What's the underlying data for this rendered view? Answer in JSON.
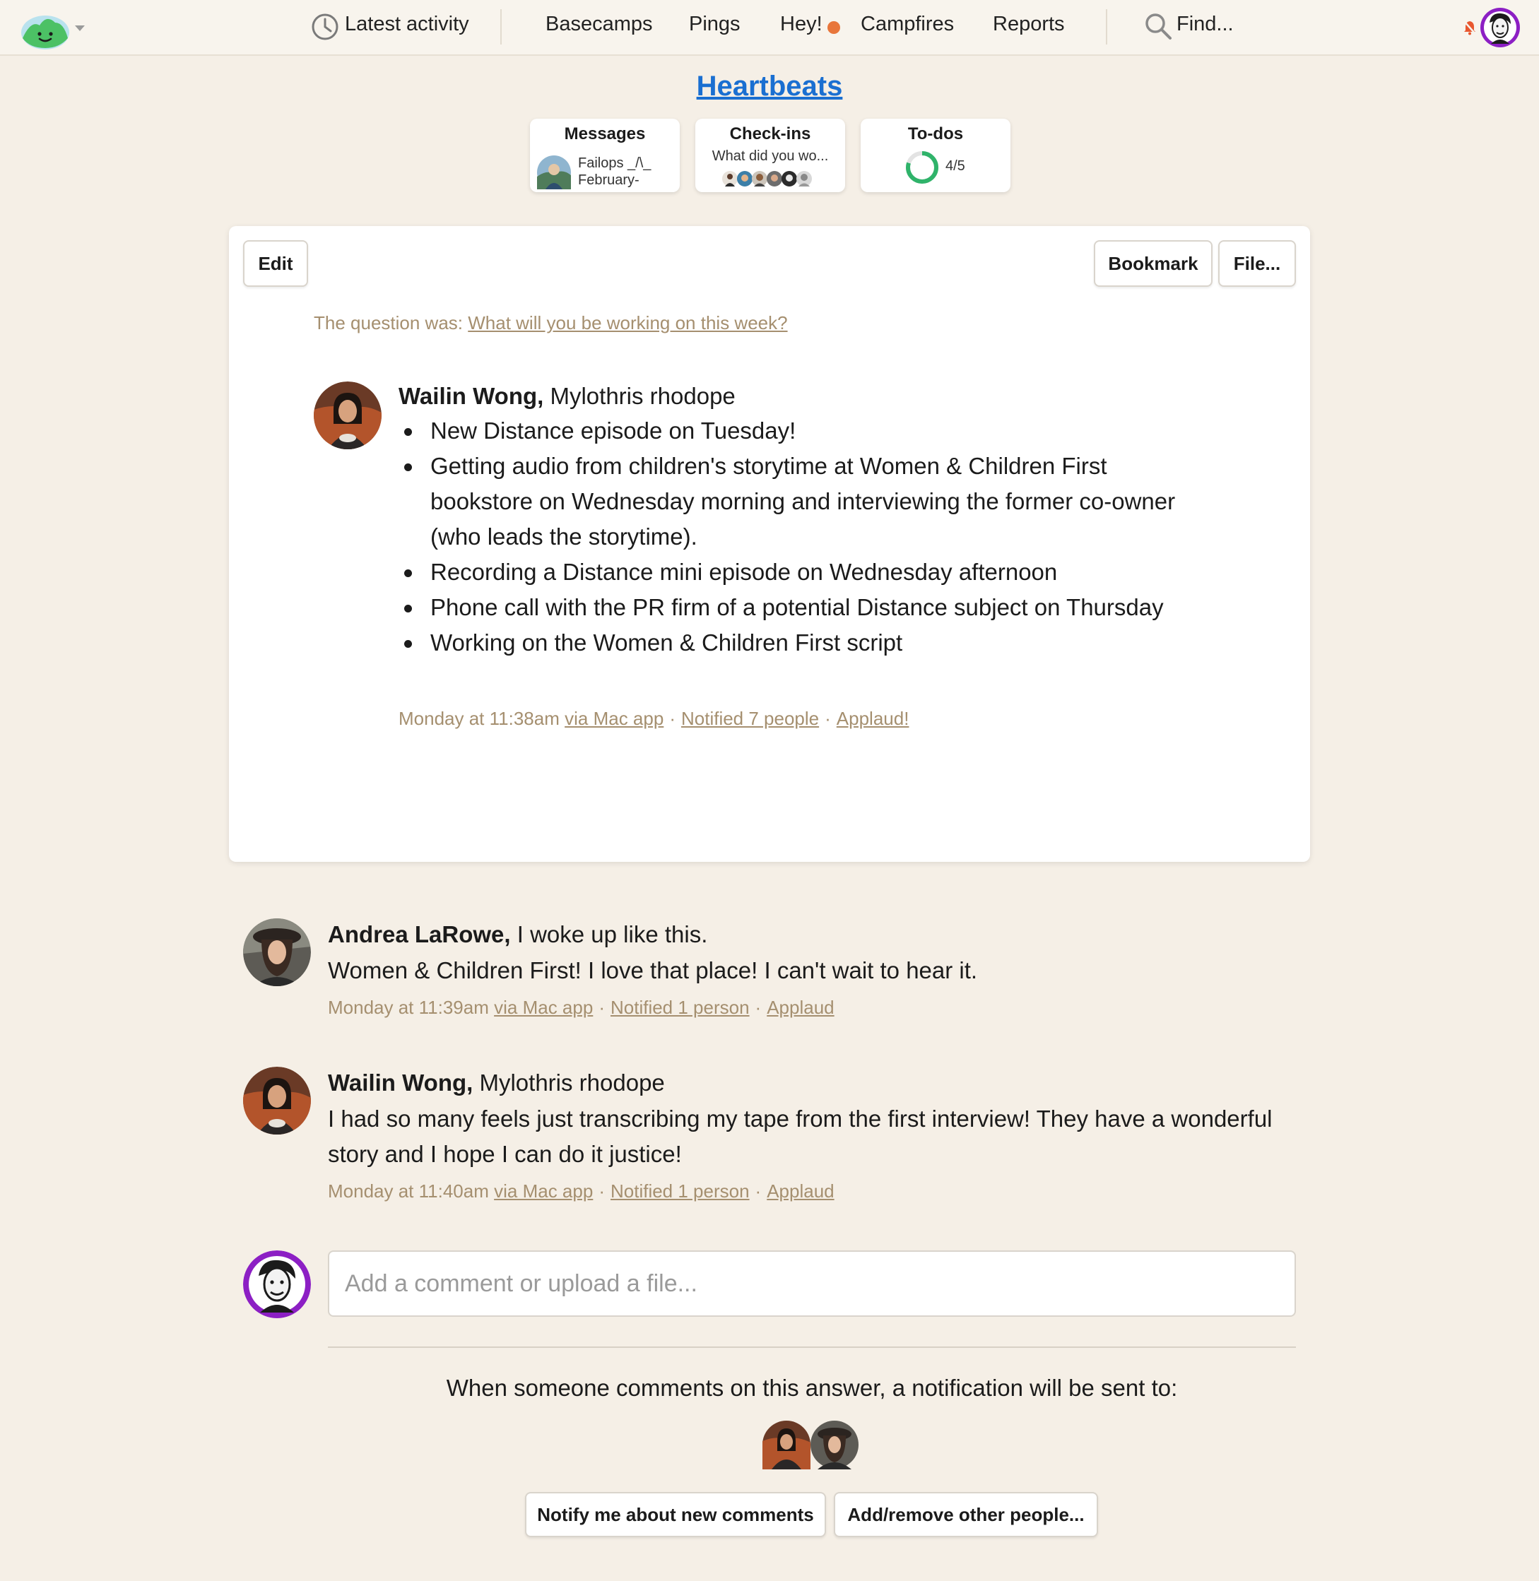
{
  "nav": {
    "latest_activity": "Latest activity",
    "basecamps": "Basecamps",
    "pings": "Pings",
    "hey": "Hey!",
    "campfires": "Campfires",
    "reports": "Reports",
    "find": "Find..."
  },
  "project": {
    "title": "Heartbeats",
    "tiles": {
      "messages": {
        "title": "Messages",
        "line1": "Failops _/\\_",
        "line2": "February-"
      },
      "checkins": {
        "title": "Check-ins",
        "line1": "What did you wo..."
      },
      "todos": {
        "title": "To-dos",
        "progress": "4/5",
        "completed_fraction": 0.8
      }
    }
  },
  "toolbar": {
    "edit": "Edit",
    "bookmark": "Bookmark",
    "file": "File..."
  },
  "answer": {
    "question_prefix": "The question was:",
    "question_link": "What will you be working on this week?",
    "author": "Wailin Wong,",
    "author_title": "Mylothris rhodope",
    "items": [
      "New Distance episode on Tuesday!",
      "Getting audio from children's storytime at Women & Children First bookstore on Wednesday morning and interviewing the former co-owner (who leads the storytime).",
      "Recording a Distance mini episode on Wednesday afternoon",
      "Phone call with the PR firm of a potential Distance subject on Thursday",
      "Working on the Women & Children First script"
    ],
    "time": "Monday at 11:38am",
    "via": "via Mac app",
    "notified": "Notified 7 people",
    "applaud": "Applaud!"
  },
  "comments": [
    {
      "author": "Andrea LaRowe,",
      "author_title": "I woke up like this.",
      "text": "Women & Children First! I love that place! I can't wait to hear it.",
      "time": "Monday at 11:39am",
      "via": "via Mac app",
      "notified": "Notified 1 person",
      "applaud": "Applaud"
    },
    {
      "author": "Wailin Wong,",
      "author_title": "Mylothris rhodope",
      "text": "I had so many feels just transcribing my tape from the first interview! They have a wonderful story and I hope I can do it justice!",
      "time": "Monday at 11:40am",
      "via": "via Mac app",
      "notified": "Notified 1 person",
      "applaud": "Applaud"
    }
  ],
  "composer": {
    "placeholder": "Add a comment or upload a file..."
  },
  "subscribers": {
    "text": "When someone comments on this answer, a notification will be sent to:",
    "notify_button": "Notify me about new comments",
    "add_remove_button": "Add/remove other people..."
  },
  "colors": {
    "background": "#f5efe6",
    "link_blue": "#1a6fd1",
    "meta_tan": "#a58f6f",
    "hey_dot": "#e8763b",
    "todo_green": "#2fb36a",
    "me_ring": "#8c1fc4"
  },
  "icons": {
    "logo": "basecamp-logo-icon",
    "latest_activity": "clock-icon",
    "find": "search-icon",
    "notifications": "bell-muted-icon"
  }
}
